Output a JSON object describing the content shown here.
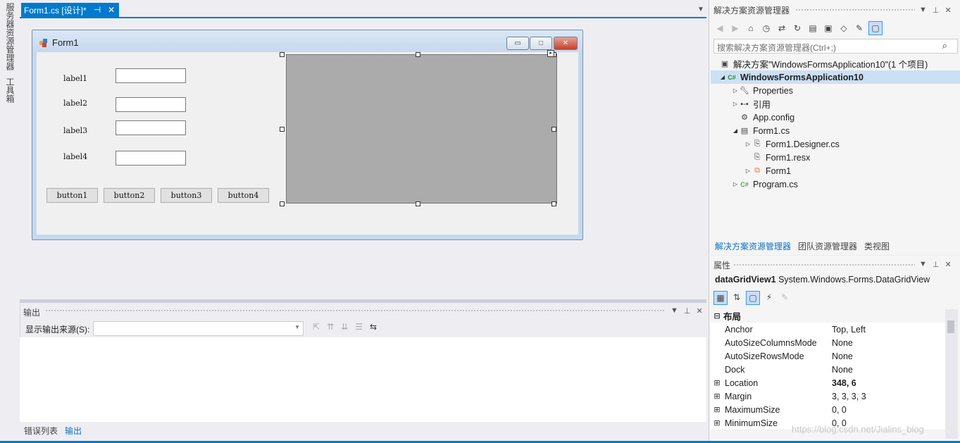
{
  "left_strip": {
    "server_explorer": "服务器资源管理器",
    "toolbox": "工具箱"
  },
  "doc_tab": {
    "title": "Form1.cs [设计]*",
    "pin_icon": "⊣",
    "close_icon": "✕"
  },
  "form": {
    "title": "Form1",
    "labels": [
      "label1",
      "label2",
      "label3",
      "label4"
    ],
    "buttons": [
      "button1",
      "button2",
      "button3",
      "button4"
    ]
  },
  "output": {
    "title": "输出",
    "source_label": "显示输出来源(S):",
    "source_value": "",
    "tabs": [
      "错误列表",
      "输出"
    ]
  },
  "solution_explorer": {
    "title": "解决方案资源管理器",
    "search_placeholder": "搜索解决方案资源管理器(Ctrl+;)",
    "tree": [
      {
        "label": "解决方案\"WindowsFormsApplication10\"(1 个项目)",
        "icon": "solution-icon"
      },
      {
        "label": "WindowsFormsApplication10",
        "icon": "csharp-project-icon"
      },
      {
        "label": "Properties",
        "icon": "wrench-icon"
      },
      {
        "label": "引用",
        "icon": "references-icon"
      },
      {
        "label": "App.config",
        "icon": "config-file-icon"
      },
      {
        "label": "Form1.cs",
        "icon": "form-icon"
      },
      {
        "label": "Form1.Designer.cs",
        "icon": "code-file-icon"
      },
      {
        "label": "Form1.resx",
        "icon": "resx-file-icon"
      },
      {
        "label": "Form1",
        "icon": "class-icon"
      },
      {
        "label": "Program.cs",
        "icon": "csharp-file-icon"
      }
    ],
    "tabs": [
      "解决方案资源管理器",
      "团队资源管理器",
      "类视图"
    ]
  },
  "properties": {
    "title": "属性",
    "object_name": "dataGridView1",
    "object_type": "System.Windows.Forms.DataGridView",
    "category": "布局",
    "rows": [
      {
        "name": "Anchor",
        "value": "Top, Left"
      },
      {
        "name": "AutoSizeColumnsMode",
        "value": "None"
      },
      {
        "name": "AutoSizeRowsMode",
        "value": "None"
      },
      {
        "name": "Dock",
        "value": "None"
      },
      {
        "name": "Location",
        "value": "348, 6"
      },
      {
        "name": "Margin",
        "value": "3, 3, 3, 3"
      },
      {
        "name": "MaximumSize",
        "value": "0, 0"
      },
      {
        "name": "MinimumSize",
        "value": "0, 0"
      }
    ]
  },
  "watermark": "https://blog.csdn.net/Jialins_blog",
  "colors": {
    "accent": "#007acc",
    "grid_bg": "#ababab"
  }
}
